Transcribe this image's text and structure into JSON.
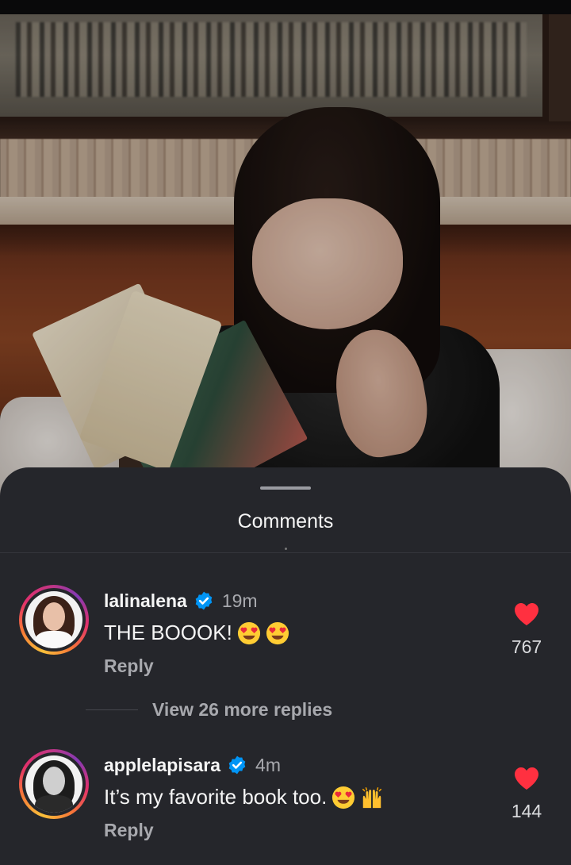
{
  "sheet": {
    "title": "Comments"
  },
  "comments": [
    {
      "username": "lalinalena",
      "verified": true,
      "time": "19m",
      "text": "THE BOOOK!",
      "emojis": [
        "heart-eyes-emoji",
        "heart-eyes-emoji"
      ],
      "reply_label": "Reply",
      "likes": "767"
    },
    {
      "username": "applelapisara",
      "verified": true,
      "time": "4m",
      "text": "It’s my favorite book too.",
      "emojis": [
        "heart-eyes-emoji",
        "raising-hands-emoji"
      ],
      "reply_label": "Reply",
      "likes": "144"
    }
  ],
  "view_more_replies": "View 26 more replies",
  "colors": {
    "sheet_bg": "#25262b",
    "text_primary": "#f5f5f5",
    "text_secondary": "#a8a9ae",
    "like_red": "#ff3040",
    "verified_blue": "#0095f6"
  },
  "icons": [
    "verified-badge-icon",
    "heart-icon",
    "drag-handle-icon"
  ]
}
